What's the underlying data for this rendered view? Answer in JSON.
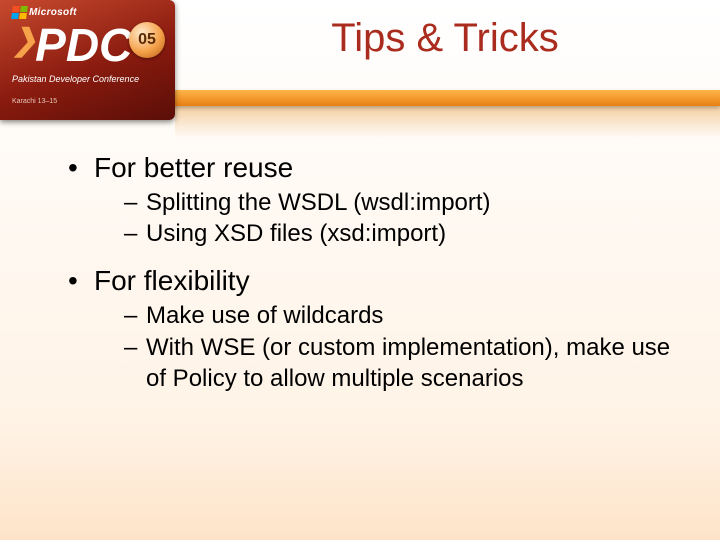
{
  "header": {
    "brand": "Microsoft",
    "logo_text": "PDC",
    "year_badge": "05",
    "subtitle_line1": "Pakistan Developer Conference",
    "subtitle_line2": "Karachi 13–15"
  },
  "title": "Tips & Tricks",
  "bullets": [
    {
      "text": "For better reuse",
      "sub": [
        "Splitting the WSDL (wsdl:import)",
        "Using XSD files (xsd:import)"
      ]
    },
    {
      "text": "For flexibility",
      "sub": [
        "Make use of wildcards",
        "With WSE (or custom implementation), make use of Policy to allow multiple scenarios"
      ]
    }
  ]
}
